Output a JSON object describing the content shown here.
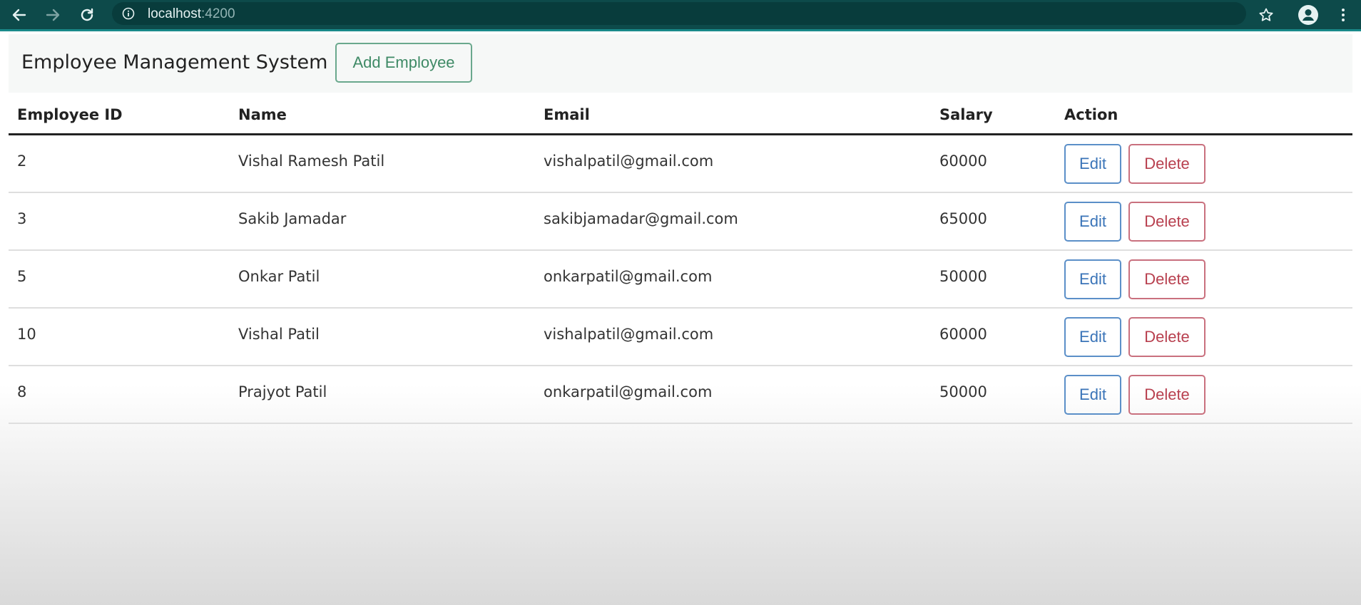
{
  "browser": {
    "url_host": "localhost",
    "url_port": ":4200",
    "icons": [
      "back-arrow-icon",
      "forward-arrow-icon",
      "reload-icon",
      "info-icon",
      "star-icon",
      "profile-icon",
      "menu-kebab-icon"
    ]
  },
  "navbar": {
    "brand": "Employee Management System",
    "add_button_label": "Add Employee"
  },
  "table": {
    "headers": {
      "id": "Employee ID",
      "name": "Name",
      "email": "Email",
      "salary": "Salary",
      "action": "Action"
    },
    "edit_label": "Edit",
    "delete_label": "Delete",
    "rows": [
      {
        "id": "2",
        "name": "Vishal Ramesh Patil",
        "email": "vishalpatil@gmail.com",
        "salary": "60000"
      },
      {
        "id": "3",
        "name": "Sakib Jamadar",
        "email": "sakibjamadar@gmail.com",
        "salary": "65000"
      },
      {
        "id": "5",
        "name": "Onkar Patil",
        "email": "onkarpatil@gmail.com",
        "salary": "50000"
      },
      {
        "id": "10",
        "name": "Vishal Patil",
        "email": "vishalpatil@gmail.com",
        "salary": "60000"
      },
      {
        "id": "8",
        "name": "Prajyot Patil",
        "email": "onkarpatil@gmail.com",
        "salary": "50000"
      }
    ]
  },
  "colors": {
    "browser_bar": "#0d4a4a",
    "success_outline": "#3f8a66",
    "primary_outline": "#3a74b8",
    "danger_outline": "#b8404f"
  }
}
